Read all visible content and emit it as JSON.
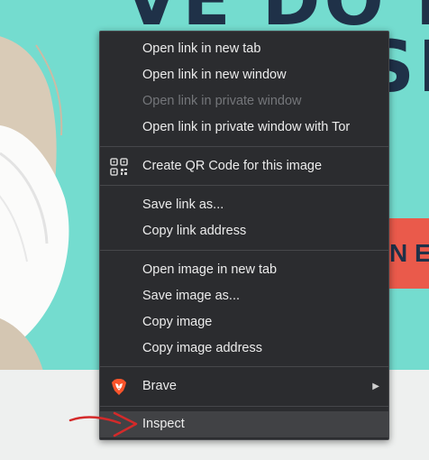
{
  "background": {
    "headline_line1": "VE DO M",
    "headline_line2": "BIG SE",
    "cta_text": "N E",
    "colors": {
      "hero": "#74dccf",
      "headline": "#1f3148",
      "cta": "#ea5a4b"
    }
  },
  "context_menu": {
    "groups": [
      [
        {
          "label": "Open link in new tab",
          "disabled": false
        },
        {
          "label": "Open link in new window",
          "disabled": false
        },
        {
          "label": "Open link in private window",
          "disabled": true
        },
        {
          "label": "Open link in private window with Tor",
          "disabled": false
        }
      ],
      [
        {
          "label": "Create QR Code for this image",
          "icon": "qr-code-icon"
        }
      ],
      [
        {
          "label": "Save link as..."
        },
        {
          "label": "Copy link address"
        }
      ],
      [
        {
          "label": "Open image in new tab"
        },
        {
          "label": "Save image as..."
        },
        {
          "label": "Copy image"
        },
        {
          "label": "Copy image address"
        }
      ],
      [
        {
          "label": "Brave",
          "icon": "brave-lion-icon",
          "submenu": true
        }
      ],
      [
        {
          "label": "Inspect",
          "highlighted": true
        }
      ]
    ],
    "colors": {
      "background": "#2b2c2f",
      "text": "#ececec",
      "disabled_text": "#74767a",
      "hover": "#414245",
      "annotation_arrow": "#d42a2a"
    }
  }
}
